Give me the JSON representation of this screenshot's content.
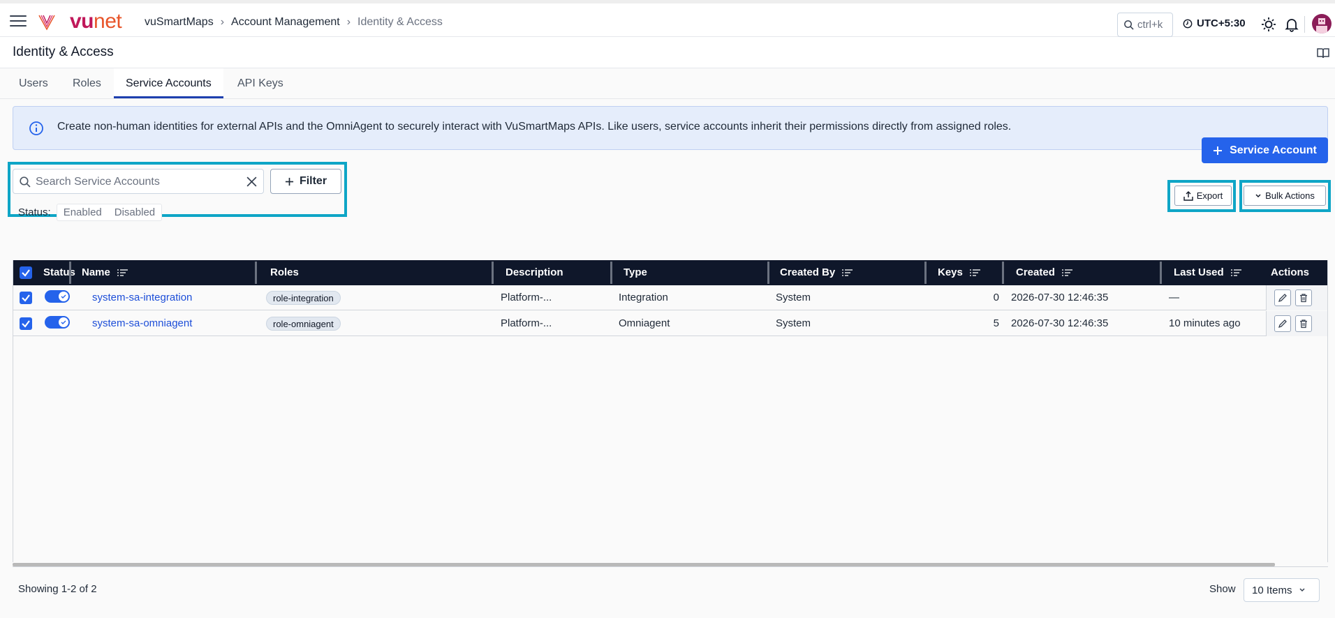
{
  "app": {
    "logo_vu": "vu",
    "logo_net": "net"
  },
  "breadcrumb": {
    "items": [
      "vuSmartMaps",
      "Account Management"
    ],
    "current": "Identity & Access"
  },
  "topbar": {
    "search_shortcut": "ctrl+k",
    "timezone": "UTC+5:30"
  },
  "page": {
    "title": "Identity & Access"
  },
  "tabs": [
    {
      "label": "Users",
      "active": false
    },
    {
      "label": "Roles",
      "active": false
    },
    {
      "label": "Service Accounts",
      "active": true
    },
    {
      "label": "API Keys",
      "active": false
    }
  ],
  "banner": {
    "text": "Create non-human identities for external APIs and the OmniAgent to securely interact with VuSmartMaps APIs. Like users, service accounts inherit their permissions directly from assigned roles."
  },
  "search": {
    "placeholder": "Search Service Accounts",
    "value": ""
  },
  "filter": {
    "label": "Filter"
  },
  "status_filter": {
    "label": "Status:",
    "options": [
      "Enabled",
      "Disabled"
    ]
  },
  "actions": {
    "add_label": "Service Account",
    "export_label": "Export",
    "bulk_label": "Bulk Actions"
  },
  "table": {
    "columns": [
      "Status",
      "Name",
      "Roles",
      "Description",
      "Type",
      "Created By",
      "Keys",
      "Created",
      "Last Used",
      "Actions"
    ],
    "rows": [
      {
        "name": "system-sa-integration",
        "role": "role-integration",
        "description": "Platform-...",
        "type": "Integration",
        "created_by": "System",
        "keys": "0",
        "created": "2026-07-30 12:46:35",
        "last_used": "—",
        "enabled": true,
        "selected": true
      },
      {
        "name": "system-sa-omniagent",
        "role": "role-omniagent",
        "description": "Platform-...",
        "type": "Omniagent",
        "created_by": "System",
        "keys": "5",
        "created": "2026-07-30 12:46:35",
        "last_used": "10 minutes ago",
        "enabled": true,
        "selected": true
      }
    ]
  },
  "pagination": {
    "summary": "Showing 1-2 of 2",
    "show_label": "Show",
    "page_size": "10 Items"
  },
  "colors": {
    "primary": "#2563eb",
    "header_bg": "#0f172a",
    "highlight": "#0ea5c6",
    "banner_bg": "#e5edfb"
  }
}
